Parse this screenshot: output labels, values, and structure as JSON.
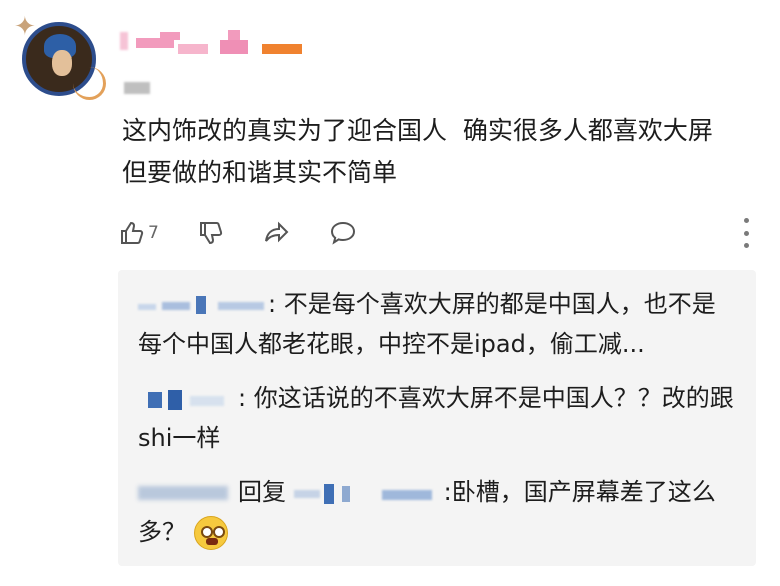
{
  "comment": {
    "text": "这内饰改的真实为了迎合国人  确实很多人都喜欢大屏  但要做的和谐其实不简单",
    "like_count": "7"
  },
  "icons": [
    "thumb-up",
    "thumb-down",
    "share",
    "comment",
    "more-vertical"
  ],
  "colors": {
    "accent_pink": "#f29bbd",
    "accent_orange": "#f0822f",
    "reply_bg": "#f4f4f4"
  },
  "replies": [
    {
      "sep": ":",
      "text": " 不是每个喜欢大屏的都是中国人，也不是每个中国人都老花眼，中控不是ipad，偷工减..."
    },
    {
      "sep": ":",
      "text": " 你这话说的不喜欢大屏不是中国人？？改的跟shi一样"
    },
    {
      "reply_word": "回复",
      "sep": ":",
      "text": "卧槽，国产屏幕差了这么多？"
    }
  ]
}
